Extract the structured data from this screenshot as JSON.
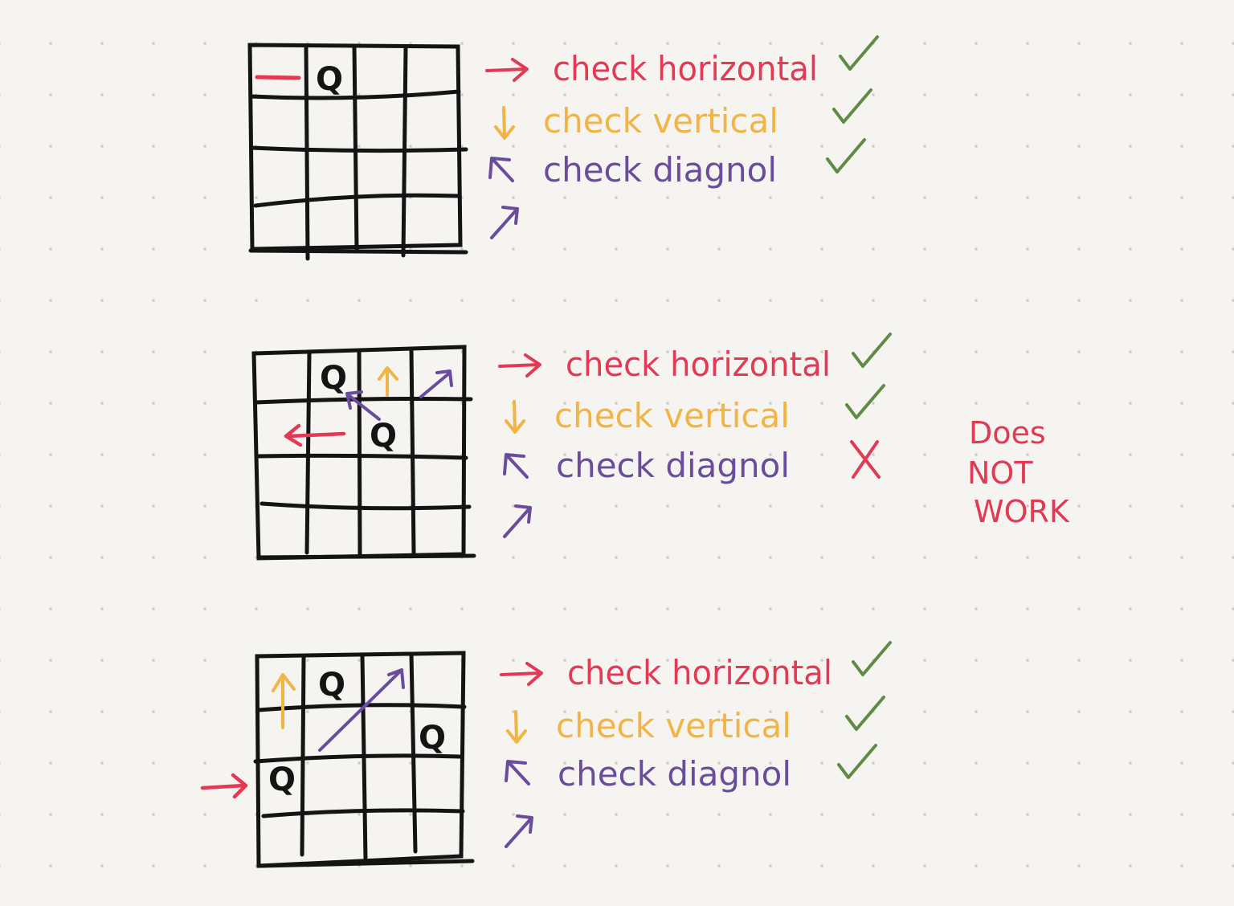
{
  "colors": {
    "ink": "#141414",
    "horizontal": "#e23a55",
    "vertical": "#f2b445",
    "diagonal": "#6a4c9c",
    "pass": "#5e8c47",
    "fail": "#e23a55"
  },
  "icons": {
    "right_arrow": "right-arrow-icon",
    "down_arrow": "down-arrow-icon",
    "up_left_arrow": "up-left-arrow-icon",
    "up_right_arrow": "up-right-arrow-icon",
    "check_mark": "check-mark-icon",
    "cross_mark": "cross-mark-icon"
  },
  "queen_letter": "Q",
  "panels": [
    {
      "checks": [
        {
          "label": "check horizontal",
          "result": "pass"
        },
        {
          "label": "check vertical",
          "result": "pass"
        },
        {
          "label": "check diagnol",
          "result": "pass"
        }
      ]
    },
    {
      "checks": [
        {
          "label": "check horizontal",
          "result": "pass"
        },
        {
          "label": "check vertical",
          "result": "pass"
        },
        {
          "label": "check diagnol",
          "result": "fail"
        }
      ],
      "note": [
        "Does",
        "NOT",
        "WORK"
      ]
    },
    {
      "checks": [
        {
          "label": "check horizontal",
          "result": "pass"
        },
        {
          "label": "check vertical",
          "result": "pass"
        },
        {
          "label": "check diagnol",
          "result": "pass"
        }
      ]
    }
  ]
}
